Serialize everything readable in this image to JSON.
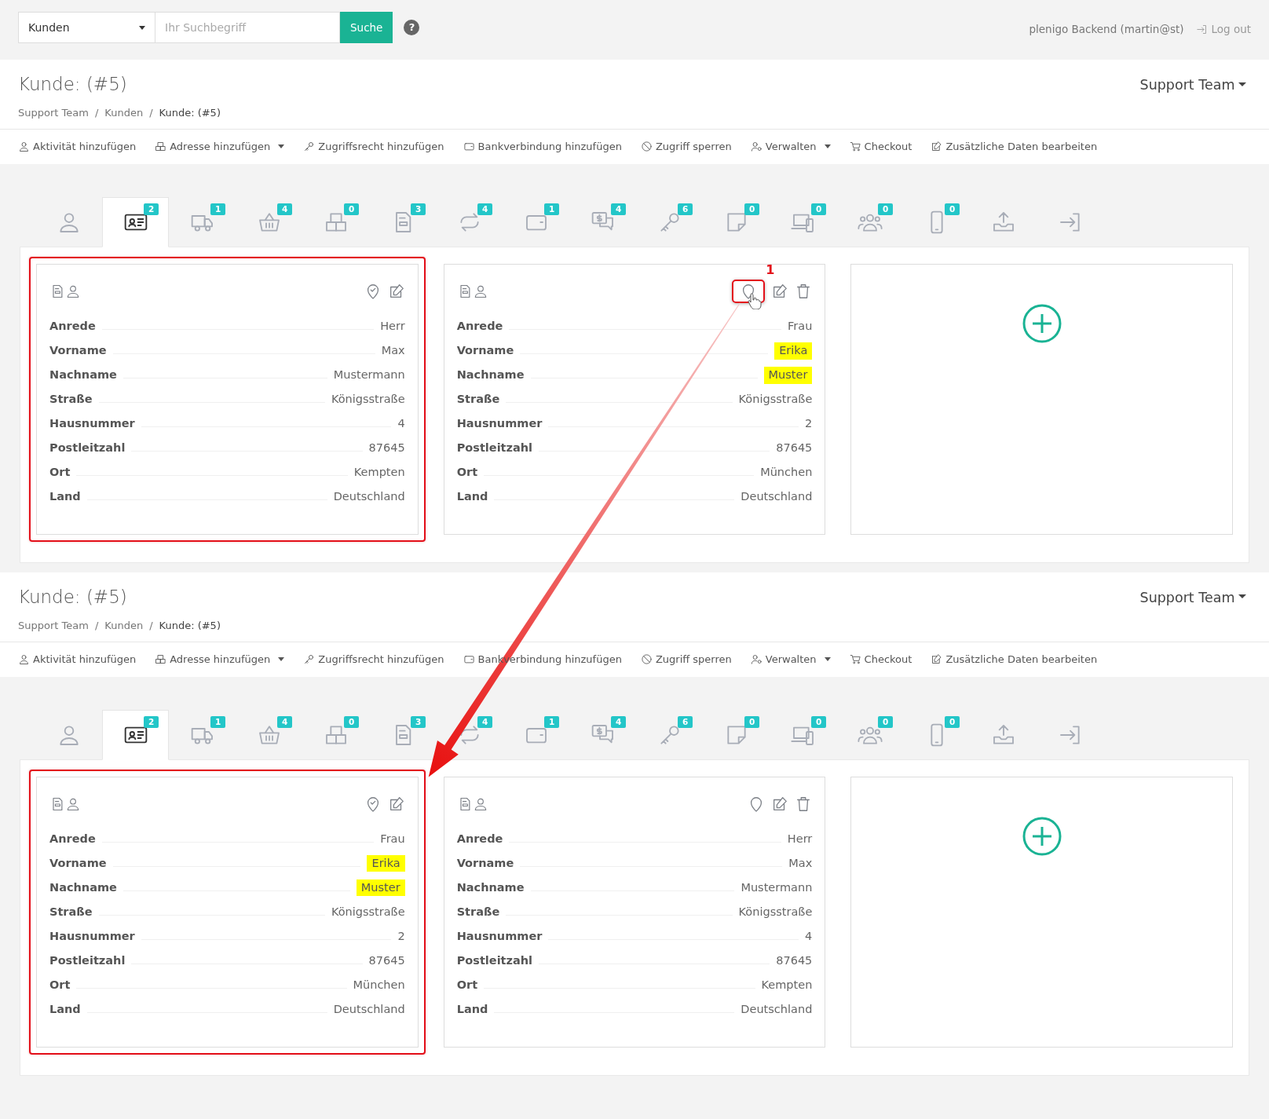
{
  "search": {
    "scope": "Kunden",
    "placeholder": "Ihr Suchbegriff",
    "button": "Suche",
    "help": "?"
  },
  "account": {
    "user": "plenigo Backend (martin@st)",
    "logout": "Log out"
  },
  "panels": [
    {
      "title": "Kunde: (#5)",
      "team": "Support Team",
      "breadcrumb": [
        {
          "label": "Support Team",
          "separator": "/",
          "current": false
        },
        {
          "label": "Kunden",
          "separator": "/",
          "current": false
        },
        {
          "label": "Kunde: (#5)",
          "current": true
        }
      ],
      "actions": [
        {
          "label": "Aktivität hinzufügen",
          "dropdown": false
        },
        {
          "label": "Adresse hinzufügen",
          "dropdown": true
        },
        {
          "label": "Zugriffsrecht hinzufügen",
          "dropdown": false
        },
        {
          "label": "Bankverbindung hinzufügen",
          "dropdown": false
        },
        {
          "label": "Zugriff sperren",
          "dropdown": false
        },
        {
          "label": "Verwalten",
          "dropdown": true
        },
        {
          "label": "Checkout",
          "dropdown": false
        },
        {
          "label": "Zusätzliche Daten bearbeiten",
          "dropdown": false
        }
      ],
      "tabs": [
        {
          "selected": false
        },
        {
          "badge": "2",
          "selected": true
        },
        {
          "badge": "1",
          "selected": false
        },
        {
          "badge": "4",
          "selected": false
        },
        {
          "badge": "0",
          "selected": false
        },
        {
          "badge": "3",
          "selected": false
        },
        {
          "badge": "4",
          "selected": false
        },
        {
          "badge": "1",
          "selected": false
        },
        {
          "badge": "4",
          "selected": false
        },
        {
          "badge": "6",
          "selected": false
        },
        {
          "badge": "0",
          "selected": false
        },
        {
          "badge": "0",
          "selected": false
        },
        {
          "badge": "0",
          "selected": false
        },
        {
          "badge": "0",
          "selected": false
        },
        {
          "selected": false
        },
        {
          "selected": false
        }
      ],
      "cards": [
        {
          "kind": "address",
          "framed": true,
          "default": true,
          "fields": [
            {
              "label": "Anrede",
              "value": "Herr",
              "marked": false
            },
            {
              "label": "Vorname",
              "value": "Max",
              "marked": false
            },
            {
              "label": "Nachname",
              "value": "Mustermann",
              "marked": false
            },
            {
              "label": "Straße",
              "value": "Königsstraße",
              "marked": false
            },
            {
              "label": "Hausnummer",
              "value": "4",
              "marked": false
            },
            {
              "label": "Postleitzahl",
              "value": "87645",
              "marked": false
            },
            {
              "label": "Ort",
              "value": "Kempten",
              "marked": false
            },
            {
              "label": "Land",
              "value": "Deutschland",
              "marked": false
            }
          ]
        },
        {
          "kind": "address",
          "framed": false,
          "default": false,
          "callout": "1",
          "fields": [
            {
              "label": "Anrede",
              "value": "Frau",
              "marked": false
            },
            {
              "label": "Vorname",
              "value": "Erika",
              "marked": true
            },
            {
              "label": "Nachname",
              "value": "Muster",
              "marked": true
            },
            {
              "label": "Straße",
              "value": "Königsstraße",
              "marked": false
            },
            {
              "label": "Hausnummer",
              "value": "2",
              "marked": false
            },
            {
              "label": "Postleitzahl",
              "value": "87645",
              "marked": false
            },
            {
              "label": "Ort",
              "value": "München",
              "marked": false
            },
            {
              "label": "Land",
              "value": "Deutschland",
              "marked": false
            }
          ]
        },
        {
          "kind": "add",
          "framed": false
        }
      ]
    },
    {
      "title": "Kunde: (#5)",
      "team": "Support Team",
      "breadcrumb": [
        {
          "label": "Support Team",
          "separator": "/",
          "current": false
        },
        {
          "label": "Kunden",
          "separator": "/",
          "current": false
        },
        {
          "label": "Kunde: (#5)",
          "current": true
        }
      ],
      "actions": [
        {
          "label": "Aktivität hinzufügen",
          "dropdown": false
        },
        {
          "label": "Adresse hinzufügen",
          "dropdown": true
        },
        {
          "label": "Zugriffsrecht hinzufügen",
          "dropdown": false
        },
        {
          "label": "Bankverbindung hinzufügen",
          "dropdown": false
        },
        {
          "label": "Zugriff sperren",
          "dropdown": false
        },
        {
          "label": "Verwalten",
          "dropdown": true
        },
        {
          "label": "Checkout",
          "dropdown": false
        },
        {
          "label": "Zusätzliche Daten bearbeiten",
          "dropdown": false
        }
      ],
      "tabs": [
        {
          "selected": false
        },
        {
          "badge": "2",
          "selected": true
        },
        {
          "badge": "1",
          "selected": false
        },
        {
          "badge": "4",
          "selected": false
        },
        {
          "badge": "0",
          "selected": false
        },
        {
          "badge": "3",
          "selected": false
        },
        {
          "badge": "4",
          "selected": false
        },
        {
          "badge": "1",
          "selected": false
        },
        {
          "badge": "4",
          "selected": false
        },
        {
          "badge": "6",
          "selected": false
        },
        {
          "badge": "0",
          "selected": false
        },
        {
          "badge": "0",
          "selected": false
        },
        {
          "badge": "0",
          "selected": false
        },
        {
          "badge": "0",
          "selected": false
        },
        {
          "selected": false
        },
        {
          "selected": false
        }
      ],
      "cards": [
        {
          "kind": "address",
          "framed": true,
          "default": true,
          "fields": [
            {
              "label": "Anrede",
              "value": "Frau",
              "marked": false
            },
            {
              "label": "Vorname",
              "value": "Erika",
              "marked": true
            },
            {
              "label": "Nachname",
              "value": "Muster",
              "marked": true
            },
            {
              "label": "Straße",
              "value": "Königsstraße",
              "marked": false
            },
            {
              "label": "Hausnummer",
              "value": "2",
              "marked": false
            },
            {
              "label": "Postleitzahl",
              "value": "87645",
              "marked": false
            },
            {
              "label": "Ort",
              "value": "München",
              "marked": false
            },
            {
              "label": "Land",
              "value": "Deutschland",
              "marked": false
            }
          ]
        },
        {
          "kind": "address",
          "framed": false,
          "default": false,
          "fields": [
            {
              "label": "Anrede",
              "value": "Herr",
              "marked": false
            },
            {
              "label": "Vorname",
              "value": "Max",
              "marked": false
            },
            {
              "label": "Nachname",
              "value": "Mustermann",
              "marked": false
            },
            {
              "label": "Straße",
              "value": "Königsstraße",
              "marked": false
            },
            {
              "label": "Hausnummer",
              "value": "4",
              "marked": false
            },
            {
              "label": "Postleitzahl",
              "value": "87645",
              "marked": false
            },
            {
              "label": "Ort",
              "value": "Kempten",
              "marked": false
            },
            {
              "label": "Land",
              "value": "Deutschland",
              "marked": false
            }
          ]
        },
        {
          "kind": "add",
          "framed": false
        }
      ]
    }
  ]
}
